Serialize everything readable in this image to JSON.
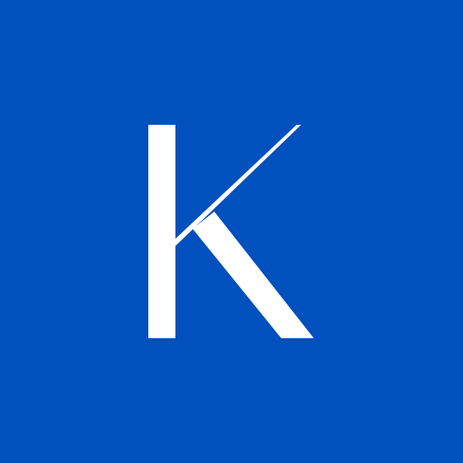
{
  "icon": {
    "name": "k-letter-logo-icon",
    "letter": "K",
    "background_color": "#0050bd",
    "foreground_color": "#ffffff"
  }
}
